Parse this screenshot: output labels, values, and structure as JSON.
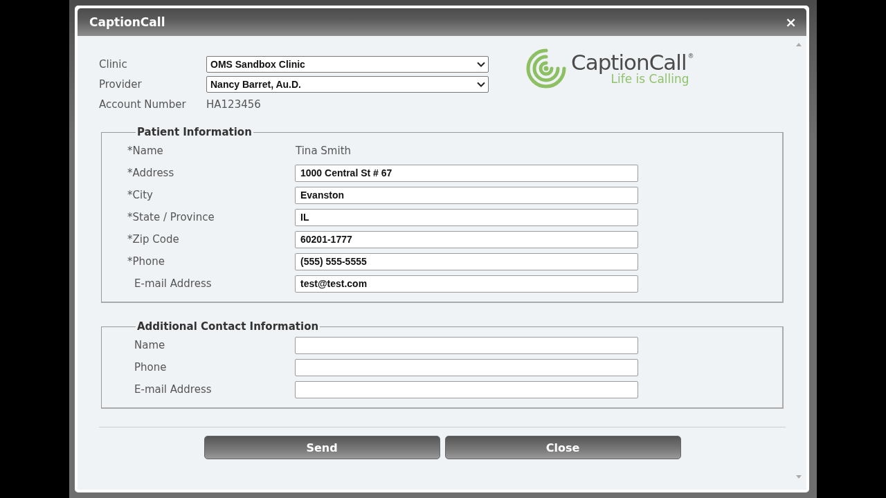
{
  "dialog": {
    "title": "CaptionCall",
    "close_glyph": "×"
  },
  "header": {
    "fields": [
      {
        "label": "Clinic",
        "kind": "select",
        "value": "OMS Sandbox Clinic"
      },
      {
        "label": "Provider",
        "kind": "select",
        "value": "Nancy Barret, Au.D."
      },
      {
        "label": "Account Number",
        "kind": "text",
        "value": "HA123456"
      }
    ]
  },
  "logo": {
    "wordmark": "CaptionCall$^{®}$",
    "tagline": "Life is Calling"
  },
  "sections": [
    {
      "legend": "Patient Information",
      "fields": [
        {
          "label": "*Name",
          "required": true,
          "kind": "text",
          "value": "Tina Smith"
        },
        {
          "label": "*Address",
          "required": true,
          "kind": "input",
          "value": "1000 Central St # 67"
        },
        {
          "label": "*City",
          "required": true,
          "kind": "input",
          "value": "Evanston"
        },
        {
          "label": "*State / Province",
          "required": true,
          "kind": "input",
          "value": "IL"
        },
        {
          "label": "*Zip Code",
          "required": true,
          "kind": "input",
          "value": "60201-1777"
        },
        {
          "label": "*Phone",
          "required": true,
          "kind": "input",
          "value": "(555) 555-5555"
        },
        {
          "label": "E-mail Address",
          "required": false,
          "kind": "input",
          "value": "test@test.com"
        }
      ]
    },
    {
      "legend": "Additional Contact Information",
      "fields": [
        {
          "label": "Name",
          "required": false,
          "kind": "input"
        },
        {
          "label": "Phone",
          "required": false,
          "kind": "input"
        },
        {
          "label": "E-mail Address",
          "required": false,
          "kind": "input"
        }
      ]
    }
  ],
  "buttons": [
    "Send",
    "Close"
  ]
}
